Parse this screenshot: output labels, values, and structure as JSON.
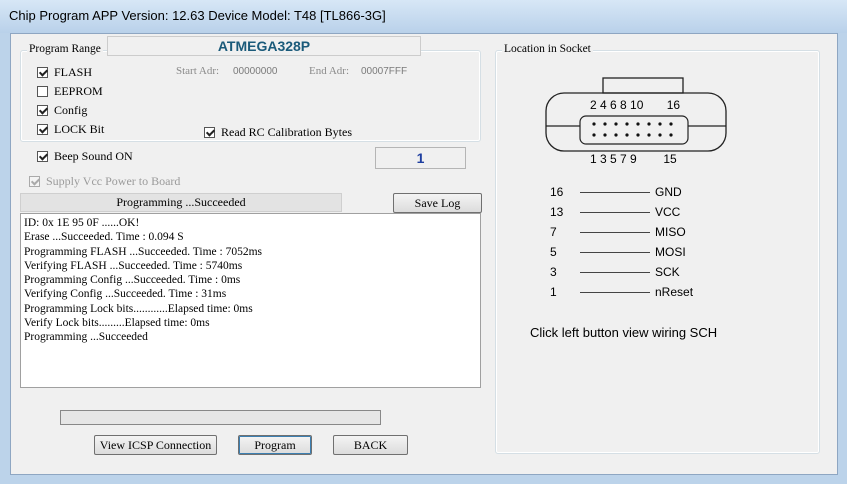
{
  "window": {
    "title": "Chip Program    APP Version: 12.63 Device Model: T48 [TL866-3G]"
  },
  "chip": {
    "name": "ATMEGA328P"
  },
  "program_range": {
    "legend": "Program Range",
    "options": [
      {
        "label": "FLASH",
        "checked": true
      },
      {
        "label": "EEPROM",
        "checked": false
      },
      {
        "label": "Config",
        "checked": true
      },
      {
        "label": "LOCK Bit",
        "checked": true
      }
    ],
    "start_adr_label": "Start Adr:",
    "start_adr_value": "00000000",
    "end_adr_label": "End Adr:",
    "end_adr_value": "00007FFF",
    "read_rc": {
      "label": "Read RC Calibration Bytes",
      "checked": true
    }
  },
  "beep": {
    "label": "Beep Sound ON",
    "checked": true
  },
  "count": "1",
  "supply_vcc": {
    "label": "Supply Vcc Power to Board",
    "checked": true,
    "disabled": true
  },
  "status": "Programming  ...Succeeded",
  "buttons": {
    "save_log": "Save Log",
    "view_icsp": "View ICSP Connection",
    "program": "Program",
    "back": "BACK"
  },
  "log_lines": [
    "ID: 0x 1E 95 0F ......OK!",
    "Erase  ...Succeeded. Time : 0.094 S",
    "Programming FLASH ...Succeeded. Time : 7052ms",
    "Verifying FLASH ...Succeeded. Time : 5740ms",
    "Programming Config ...Succeeded. Time : 0ms",
    "Verifying Config ...Succeeded. Time : 31ms",
    "Programming Lock bits............Elapsed time: 0ms",
    "Verify Lock bits.........Elapsed time: 0ms",
    "Programming  ...Succeeded"
  ],
  "progress_fraction": 0.0,
  "socket": {
    "legend": "Location in Socket",
    "top_pins": "2 4 6 8 10       16",
    "bottom_pins": "1 3 5 7 9        15",
    "pinmap": [
      {
        "pin": "16",
        "signal": "GND"
      },
      {
        "pin": "13",
        "signal": "VCC"
      },
      {
        "pin": "7",
        "signal": "MISO"
      },
      {
        "pin": "5",
        "signal": "MOSI"
      },
      {
        "pin": "3",
        "signal": "SCK"
      },
      {
        "pin": "1",
        "signal": "nReset"
      }
    ],
    "hint": "Click left button view wiring SCH"
  },
  "colors": {
    "frame": "#bcd3ea",
    "chip_name": "#1a5a7a",
    "count": "#1f3fa0",
    "progress_fill": "#3fbf3f"
  }
}
